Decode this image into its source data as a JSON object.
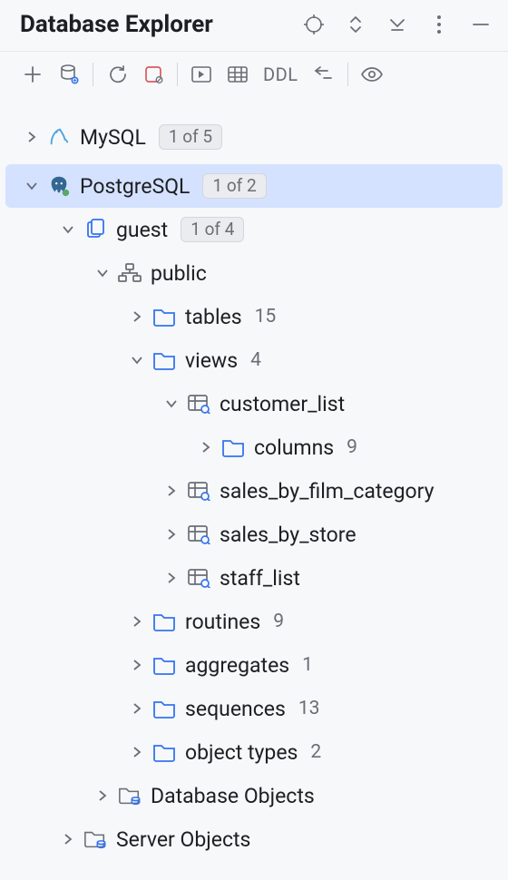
{
  "panel": {
    "title": "Database Explorer"
  },
  "toolbar": {
    "ddl_label": "DDL"
  },
  "tree": {
    "mysql": {
      "label": "MySQL",
      "badge": "1 of 5"
    },
    "postgres": {
      "label": "PostgreSQL",
      "badge": "1 of 2"
    },
    "guest": {
      "label": "guest",
      "badge": "1 of 4"
    },
    "public": {
      "label": "public"
    },
    "tables": {
      "label": "tables",
      "count": "15"
    },
    "views": {
      "label": "views",
      "count": "4"
    },
    "customer_list": {
      "label": "customer_list"
    },
    "columns": {
      "label": "columns",
      "count": "9"
    },
    "sales_film": {
      "label": "sales_by_film_category"
    },
    "sales_store": {
      "label": "sales_by_store"
    },
    "staff_list": {
      "label": "staff_list"
    },
    "routines": {
      "label": "routines",
      "count": "9"
    },
    "aggregates": {
      "label": "aggregates",
      "count": "1"
    },
    "sequences": {
      "label": "sequences",
      "count": "13"
    },
    "object_types": {
      "label": "object types",
      "count": "2"
    },
    "db_objects": {
      "label": "Database Objects"
    },
    "srv_objects": {
      "label": "Server Objects"
    }
  }
}
